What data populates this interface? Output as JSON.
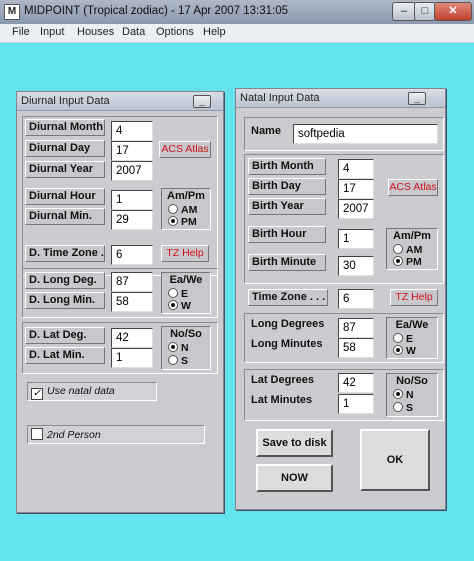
{
  "titlebar": {
    "title": "MIDPOINT  (Tropical zodiac) - 17 Apr 2007     13:31:05",
    "icon_glyph": "M",
    "minimize": "–",
    "maximize": "□",
    "close": "✕"
  },
  "menu": [
    "File",
    "Input",
    "Houses",
    "Data",
    "Options",
    "Help"
  ],
  "diurnal": {
    "title": "Diurnal Input Data",
    "minimize_glyph": "_",
    "month_label": "Diurnal Month",
    "month": "4",
    "day_label": "Diurnal Day",
    "day": "17",
    "year_label": "Diurnal Year",
    "year": "2007",
    "acs_atlas": "ACS Atlas",
    "hour_label": "Diurnal Hour",
    "hour": "1",
    "min_label": "Diurnal Min.",
    "min": "29",
    "ampm_title": "Am/Pm",
    "am": "AM",
    "pm": "PM",
    "tz_label": "D. Time Zone .",
    "tz": "6",
    "tz_help": "TZ Help",
    "long_deg_label": "D. Long Deg.",
    "long_deg": "87",
    "long_min_label": "D. Long Min.",
    "long_min": "58",
    "eawe_title": "Ea/We",
    "e": "E",
    "w": "W",
    "lat_deg_label": "D. Lat Deg.",
    "lat_deg": "42",
    "lat_min_label": "D. Lat Min.",
    "lat_min": "1",
    "noso_title": "No/So",
    "n": "N",
    "s": "S",
    "use_natal": "Use natal data",
    "second_person": "2nd Person"
  },
  "natal": {
    "title": "Natal Input Data",
    "minimize_glyph": "_",
    "name_label": "Name",
    "name": "softpedia",
    "month_label": "Birth Month",
    "month": "4",
    "day_label": "Birth Day",
    "day": "17",
    "year_label": "Birth Year",
    "year": "2007",
    "acs_atlas": "ACS Atlas",
    "hour_label": "Birth Hour",
    "hour": "1",
    "minute_label": "Birth Minute",
    "minute": "30",
    "ampm_title": "Am/Pm",
    "am": "AM",
    "pm": "PM",
    "tz_label": "Time Zone . . .",
    "tz": "6",
    "tz_help": "TZ Help",
    "long_deg_label": "Long Degrees",
    "long_deg": "87",
    "long_min_label": "Long Minutes",
    "long_min": "58",
    "eawe_title": "Ea/We",
    "e": "E",
    "w": "W",
    "lat_deg_label": "Lat Degrees",
    "lat_deg": "42",
    "lat_min_label": "Lat Minutes",
    "lat_min": "1",
    "noso_title": "No/So",
    "n": "N",
    "s": "S",
    "save": "Save to disk",
    "now": "NOW",
    "ok": "OK"
  }
}
